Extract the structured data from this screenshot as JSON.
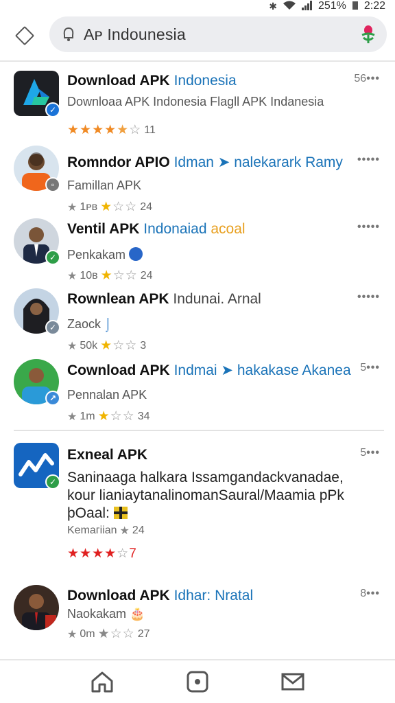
{
  "status": {
    "battery_percent": "251%",
    "time": "2:22"
  },
  "search": {
    "query": "Aᴘ Indounesia"
  },
  "results": [
    {
      "title": "Download APK",
      "title_accent": "Indonesia",
      "accent_color": "#1a73b8",
      "subtitle": "Downloaa APK Indonesia Flagll APK Indanesia",
      "meta_text": "11",
      "rating_stars": 4,
      "more_label": "56"
    },
    {
      "title": "Romndor APIO",
      "title_accent": "Idman ➤ nalekarark Ramy",
      "accent_color": "#1a73b8",
      "subtitle": "Famillan APK",
      "meta_prefix": "1ᴘʙ",
      "meta_text": "24",
      "rating_stars": 1,
      "more_label": ""
    },
    {
      "title": "Ventil APK",
      "title_accent": "Indonaiad",
      "title_accent2": "acoal",
      "accent_color": "#1a73b8",
      "accent2_color": "#e8a020",
      "subtitle": "Penkakam",
      "meta_prefix": "10ʙ",
      "meta_text": "24",
      "rating_stars": 1,
      "more_label": ""
    },
    {
      "title": "Rownlean APK",
      "title_accent": "Indunai. Arnal",
      "accent_color": "#444444",
      "subtitle": "Zaock",
      "meta_prefix": "50k",
      "meta_text": "3",
      "rating_stars": 1,
      "more_label": ""
    },
    {
      "title": "Cownload APK",
      "title_accent": "Indmai ➤ hakakase Akanea",
      "accent_color": "#1a73b8",
      "subtitle": "Pennalan APK",
      "meta_prefix": "1m",
      "meta_text": "34",
      "rating_stars": 1,
      "more_label": "5"
    },
    {
      "title": "Exneal APK",
      "title_accent": "",
      "accent_color": "#1a73b8",
      "description": "Saninaaga halkara Issamgandackvanadae, kour lianiaytanalinomanSaural/Maamia pPk þOaal:",
      "meta_prefix": "Kemaгiian",
      "meta_text": "24",
      "rating_stars": 4,
      "more_label": "5"
    },
    {
      "title": "Download APK",
      "title_accent": "Idhar: Nratal",
      "accent_color": "#1a73b8",
      "subtitle": "Naokakam",
      "meta_prefix": "0m",
      "meta_text": "27",
      "rating_stars": 1,
      "more_label": "8"
    }
  ],
  "nav": {
    "items": [
      "home-icon",
      "camera-icon",
      "mail-icon"
    ]
  },
  "colors": {
    "brand_blue": "#1565c0",
    "star_orange": "#f08a24",
    "star_red": "#e02020",
    "star_yellow": "#f0b400"
  }
}
